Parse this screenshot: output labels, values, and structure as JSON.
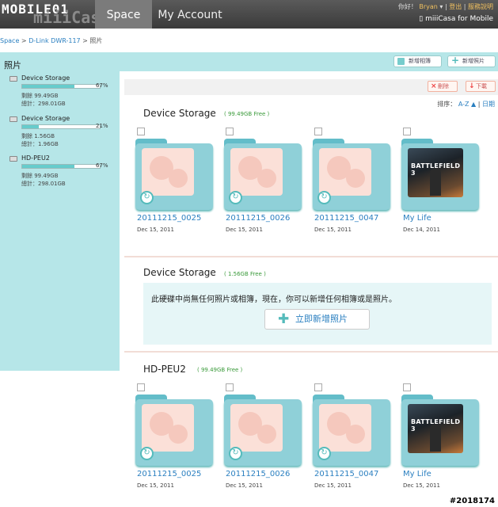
{
  "header": {
    "logo": "MOBILE01",
    "logo_sub": "miiiCasa",
    "tabs": [
      {
        "label": "Space"
      },
      {
        "label": "My Account"
      }
    ],
    "greeting": "你好！",
    "user": "Bryan",
    "logout": "登出",
    "help": "服務說明",
    "mobile_link": "miiiCasa for Mobile"
  },
  "breadcrumb": {
    "items": [
      "Space",
      "D-Link DWR-117",
      "照片"
    ]
  },
  "page": {
    "title": "照片"
  },
  "toolbar": {
    "new_album": "新增相簿",
    "new_photo": "新增照片",
    "delete": "刪除",
    "download": "下載",
    "sort_label": "排序：",
    "sort_az": "A-Z",
    "sort_date": "日期"
  },
  "sidebar": {
    "devices": [
      {
        "name": "Device Storage",
        "percent": 67,
        "percent_label": "67%",
        "free": "剩餘 99.49GB",
        "total": "總計：298.01GB"
      },
      {
        "name": "Device Storage",
        "percent": 21,
        "percent_label": "21%",
        "free": "剩餘 1.56GB",
        "total": "總計：1.96GB"
      },
      {
        "name": "HD-PEU2",
        "percent": 67,
        "percent_label": "67%",
        "free": "剩餘 99.49GB",
        "total": "總計：298.01GB"
      }
    ]
  },
  "sections": [
    {
      "title": "Device Storage",
      "free": "( 99.49GB Free )",
      "albums": [
        {
          "name": "20111215_0025",
          "date": "Dec 15, 2011",
          "cover": "placeholder"
        },
        {
          "name": "20111215_0026",
          "date": "Dec 15, 2011",
          "cover": "placeholder"
        },
        {
          "name": "20111215_0047",
          "date": "Dec 15, 2011",
          "cover": "placeholder"
        },
        {
          "name": "My Life",
          "date": "Dec 14, 2011",
          "cover": "photo",
          "cover_text": "BATTLEFIELD 3"
        }
      ]
    },
    {
      "title": "Device Storage",
      "free": "( 1.56GB Free )",
      "empty_message": "此硬碟中尚無任何照片或相簿，現在，你可以新增任何相簿或是照片。",
      "create_button": "立即新增照片"
    },
    {
      "title": "HD-PEU2",
      "free": "( 99.49GB Free )",
      "albums": [
        {
          "name": "20111215_0025",
          "date": "Dec 15, 2011",
          "cover": "placeholder"
        },
        {
          "name": "20111215_0026",
          "date": "Dec 15, 2011",
          "cover": "placeholder"
        },
        {
          "name": "20111215_0047",
          "date": "Dec 15, 2011",
          "cover": "placeholder"
        },
        {
          "name": "My Life",
          "date": "Dec 15, 2011",
          "cover": "photo",
          "cover_text": "BATTLEFIELD 3"
        }
      ]
    }
  ],
  "watermark": "#2018174",
  "colors": {
    "teal": "#b6e6e8",
    "link": "#2a7fc0",
    "free_green": "#3a9a3a",
    "folder": "#8fd0d8"
  }
}
